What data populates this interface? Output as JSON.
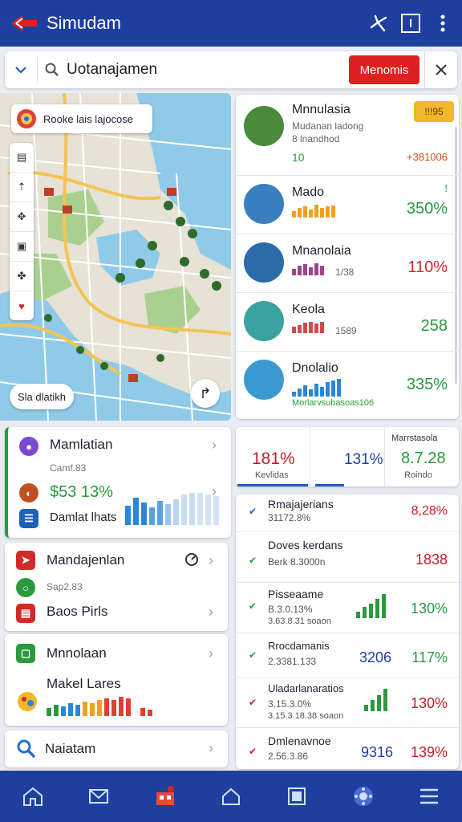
{
  "app": {
    "title": "Simudam"
  },
  "search": {
    "query": "Uotanajamen",
    "action_label": "Menomis"
  },
  "map": {
    "chip_label": "Rooke lais lajocose",
    "tools": [
      "▤",
      "⇡",
      "✥",
      "▣",
      "✤",
      "♥"
    ],
    "bottom_button": "Sla dlatikh",
    "fab_icon": "↱"
  },
  "right_list": {
    "badge": "!!!95",
    "items": [
      {
        "name": "Mnnulasia",
        "sub1": "Mudanan ladong",
        "sub2": "8 lnandhod",
        "left": "10",
        "right": "+381006",
        "avatar_color": "#4a8a3d",
        "spark_color": "#f0a020",
        "pct_color": "#d84a1b"
      },
      {
        "name": "Mado",
        "left": "",
        "right": "350%",
        "avatar_color": "#3a7fc0",
        "spark_color": "#f0a020",
        "pct_color": "#2a9a3c",
        "flag": "!"
      },
      {
        "name": "Mnanolaia",
        "sub1": "1/38",
        "right": "110%",
        "avatar_color": "#2d6aa8",
        "spark_color": "#a0448a",
        "pct_color": "#d42a2a"
      },
      {
        "name": "Keola",
        "sub1": "1589",
        "right": "258",
        "avatar_color": "#3aa3a0",
        "spark_color": "#d04a4a",
        "pct_color": "#2a9a3c"
      },
      {
        "name": "Dnolalio",
        "sub1": "Morlarvsubasoas106",
        "right": "335%",
        "avatar_color": "#3a9ad0",
        "spark_color": "#2a86d8",
        "pct_color": "#2a9a3c"
      }
    ]
  },
  "left_cards": {
    "card1": {
      "title": "Mamlatian",
      "sub": "Camf.83",
      "value": "$53 13%",
      "row2": "Damlat lhats"
    },
    "card2": {
      "row1": "Mandajenlan",
      "sub": "Sap2.83",
      "row2": "Baos Pirls"
    },
    "card3": {
      "row1": "Mnnolaan",
      "row2": "Makel Lares"
    },
    "card4": {
      "row1": "Naiatam"
    }
  },
  "stats": [
    {
      "value": "181%",
      "label": "Kevlidas",
      "color": "#c0202a"
    },
    {
      "value": "131%",
      "label": "",
      "color": "#1f3f9e"
    },
    {
      "value": "8.7.28",
      "label": "Roindo",
      "head": "Marrstasola",
      "color": "#2a9a3c"
    }
  ],
  "table": {
    "rows": [
      {
        "name": "Rmajajerians",
        "sub": "31172.8%",
        "value": "8,28%",
        "value_color": "#c0202a",
        "mid": ""
      },
      {
        "name": "Doves kerdans",
        "sub": "Berk 8.3000n",
        "value": "1838",
        "value_color": "#c0202a",
        "mid": ""
      },
      {
        "name": "Pisseaame",
        "sub": "B.3.0.13%",
        "sub2": "3.63.8.31 soaon",
        "value": "130%",
        "value_color": "#2a9a3c",
        "mid": ""
      },
      {
        "name": "Rrocdamanis",
        "sub": "2.3381.133",
        "value": "117%",
        "value_color": "#2a9a3c",
        "mid": "3206"
      },
      {
        "name": "Uladarlanaratios",
        "sub": "3.15.3.0%",
        "sub2": "3.15.3.18.38 soaon",
        "value": "130%",
        "value_color": "#c0202a",
        "mid": ""
      },
      {
        "name": "Dmlenavnoe",
        "sub": "2.56.3.86",
        "value": "139%",
        "value_color": "#c0202a",
        "mid": "9316"
      }
    ]
  },
  "nav": {
    "items": [
      "home-icon",
      "mail-icon",
      "store-icon",
      "house-icon",
      "document-icon",
      "settings-icon",
      "menu-icon"
    ]
  }
}
